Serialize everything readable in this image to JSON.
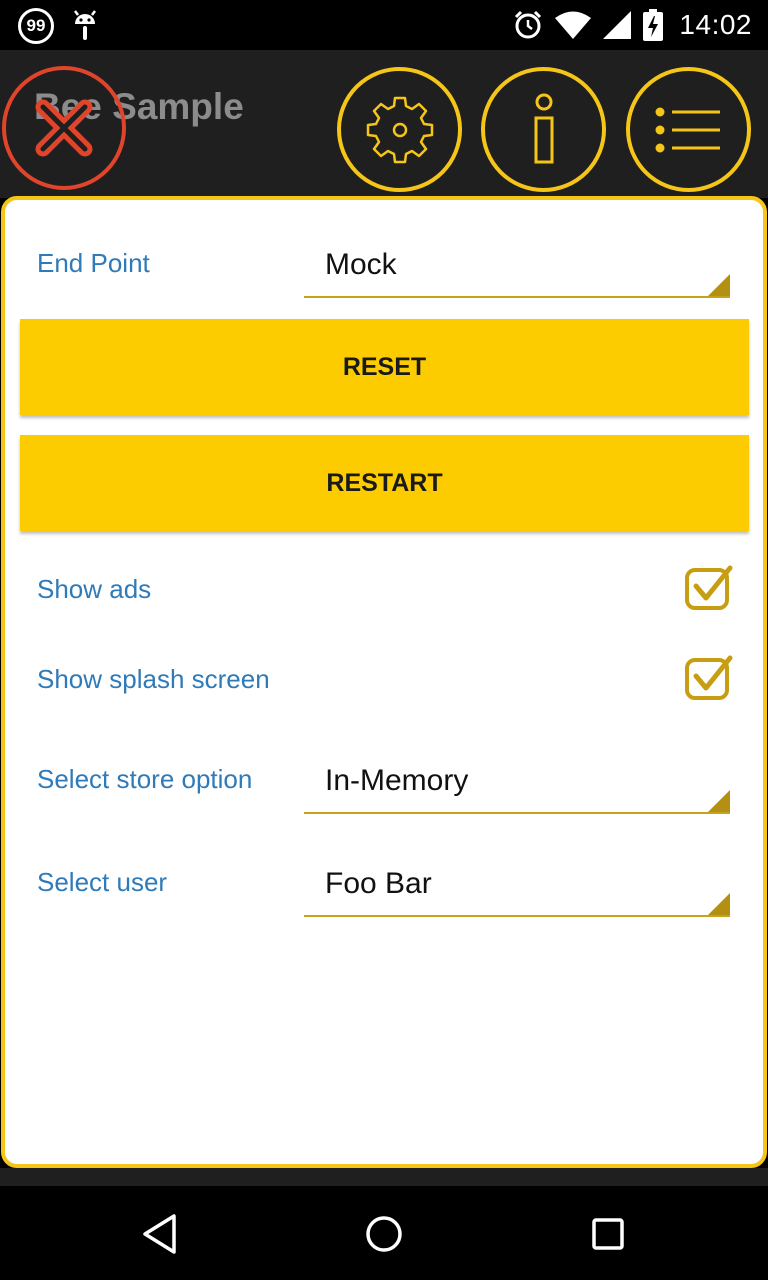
{
  "status_bar": {
    "notification_badge": "99",
    "time": "14:02",
    "icons": [
      "android-debug-icon",
      "alarm-icon",
      "wifi-icon",
      "cell-signal-icon",
      "battery-charging-icon"
    ]
  },
  "action_bar": {
    "title": "Bee Sample",
    "buttons": [
      "close-icon",
      "gear-icon",
      "info-icon",
      "list-menu-icon"
    ]
  },
  "settings": {
    "end_point": {
      "label": "End Point",
      "value": "Mock"
    },
    "reset_label": "RESET",
    "restart_label": "RESTART",
    "show_ads": {
      "label": "Show ads",
      "checked": true
    },
    "show_splash": {
      "label": "Show splash screen",
      "checked": true
    },
    "store_option": {
      "label": "Select store option",
      "value": "In-Memory"
    },
    "user": {
      "label": "Select user",
      "value": "Foo Bar"
    }
  },
  "nav_bar": {
    "buttons": [
      "back-icon",
      "home-icon",
      "recents-icon"
    ]
  },
  "colors": {
    "accent": "#f5c518",
    "button": "#fccc00",
    "label": "#2f7ab8",
    "close": "#e0442b"
  }
}
